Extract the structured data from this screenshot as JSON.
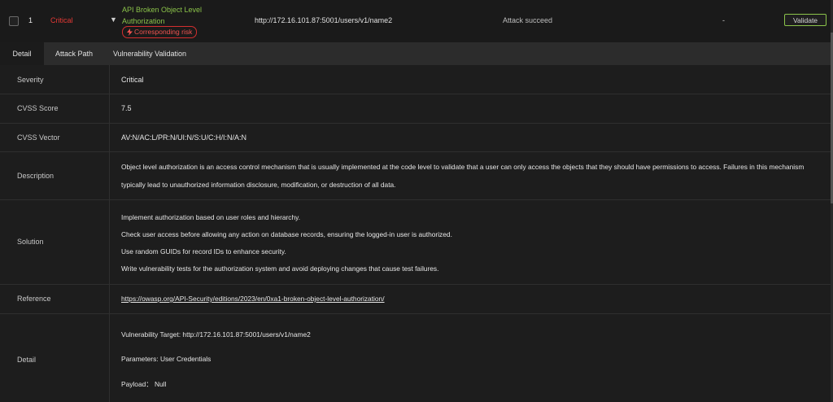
{
  "header": {
    "row_number": "1",
    "severity": "Critical",
    "vuln_name": "API Broken Object Level Authorization",
    "risk_label": "Corresponding risk",
    "url": "http://172.16.101.87:5001/users/v1/name2",
    "status": "Attack succeed",
    "dash": "-",
    "validate_label": "Validate"
  },
  "tabs": [
    {
      "label": "Detail"
    },
    {
      "label": "Attack Path"
    },
    {
      "label": "Vulnerability Validation"
    }
  ],
  "details": {
    "severity_label": "Severity",
    "severity_value": "Critical",
    "cvss_score_label": "CVSS Score",
    "cvss_score_value": "7.5",
    "cvss_vector_label": "CVSS Vector",
    "cvss_vector_value": "AV:N/AC:L/PR:N/UI:N/S:U/C:H/I:N/A:N",
    "description_label": "Description",
    "description_line1": "Object level authorization is an access control mechanism that is usually implemented at the code level to validate that a user can only access the objects that they should have permissions to access. Failures in this mechanism",
    "description_line2": "typically lead to unauthorized information disclosure, modification, or destruction of all data.",
    "solution_label": "Solution",
    "solution_lines": [
      "Implement authorization based on user roles and hierarchy.",
      "Check user access before allowing any action on database records, ensuring the logged-in user is authorized.",
      "Use random GUIDs for record IDs to enhance security.",
      "Write vulnerability tests for the authorization system and avoid deploying changes that cause test failures."
    ],
    "reference_label": "Reference",
    "reference_value": "https://owasp.org/API-Security/editions/2023/en/0xa1-broken-object-level-authorization/",
    "detail_label": "Detail",
    "detail_target": "Vulnerability Target: http://172.16.101.87:5001/users/v1/name2",
    "detail_parameters": "Parameters: User Credentials",
    "detail_payload": "Payload： Null"
  },
  "colors": {
    "critical": "#e53935",
    "accent_green": "#8bc34a",
    "background": "#1b1b1b"
  },
  "icons": {
    "risk": "bolt-icon",
    "expand": "caret-down-icon"
  }
}
